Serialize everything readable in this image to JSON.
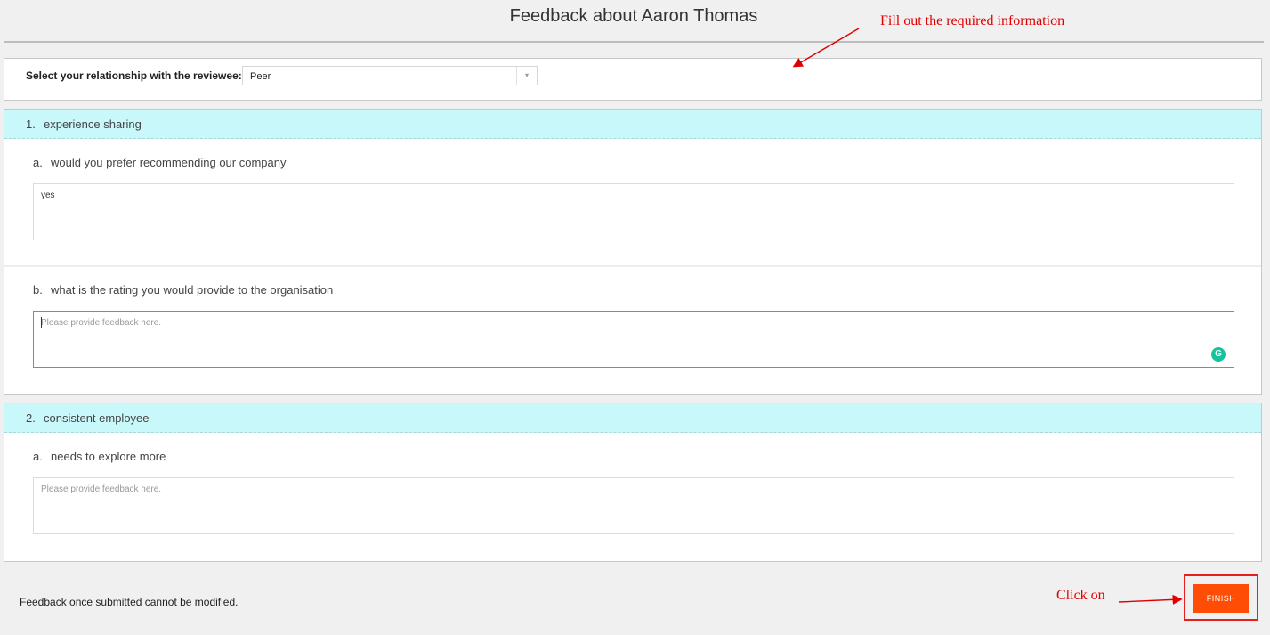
{
  "page": {
    "title": "Feedback about Aaron Thomas"
  },
  "relationship": {
    "label": "Select your relationship with the reviewee:",
    "selected": "Peer",
    "arrow_icon": "▾"
  },
  "sections": [
    {
      "number": "1.",
      "title": "experience sharing",
      "questions": [
        {
          "letter": "a.",
          "text": "would you prefer recommending our company",
          "answer": "yes",
          "placeholder": "Please provide feedback here."
        },
        {
          "letter": "b.",
          "text": "what is the rating you would provide to the organisation",
          "answer": "",
          "placeholder": "Please provide feedback here."
        }
      ]
    },
    {
      "number": "2.",
      "title": "consistent employee",
      "questions": [
        {
          "letter": "a.",
          "text": "needs to explore more",
          "answer": "",
          "placeholder": "Please provide feedback here."
        }
      ]
    }
  ],
  "footer": {
    "note": "Feedback once submitted cannot be modified.",
    "finish_label": "FINISH"
  },
  "annotations": {
    "fill_out": "Fill out the required information",
    "click_on": "Click on",
    "color": "#e00000"
  },
  "icons": {
    "grammarly": "G"
  },
  "colors": {
    "section_header": "#c9f8fb",
    "finish_button": "#ff4d05"
  }
}
